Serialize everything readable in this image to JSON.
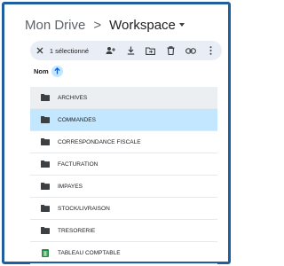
{
  "breadcrumb": {
    "root": "Mon Drive",
    "separator": ">",
    "current": "Workspace"
  },
  "toolbar": {
    "selection_count": "1 sélectionné",
    "icons": [
      "close-icon",
      "share-person-icon",
      "download-icon",
      "move-to-folder-icon",
      "trash-icon",
      "link-icon",
      "more-vertical-icon"
    ]
  },
  "sort": {
    "label": "Nom",
    "direction_icon": "arrow-up-icon"
  },
  "files": [
    {
      "name": "ARCHIVES",
      "type": "folder",
      "state": "hover"
    },
    {
      "name": "COMMANDES",
      "type": "folder",
      "state": "selected"
    },
    {
      "name": "CORRESPONDANCE FISCALE",
      "type": "folder",
      "state": ""
    },
    {
      "name": "FACTURATION",
      "type": "folder",
      "state": ""
    },
    {
      "name": "IMPAYES",
      "type": "folder",
      "state": ""
    },
    {
      "name": "STOCK/LIVRAISON",
      "type": "folder",
      "state": ""
    },
    {
      "name": "TRESORERIE",
      "type": "folder",
      "state": ""
    },
    {
      "name": "TABLEAU COMPTABLE",
      "type": "spreadsheet",
      "state": ""
    }
  ],
  "colors": {
    "frame_border": "#1f5fa0",
    "selected_row": "#c2e7ff",
    "hover_row": "#eceff1",
    "toolbar_bg": "#e9eef6",
    "folder_icon": "#3c4043",
    "sheet_icon": "#1e8e3e"
  }
}
